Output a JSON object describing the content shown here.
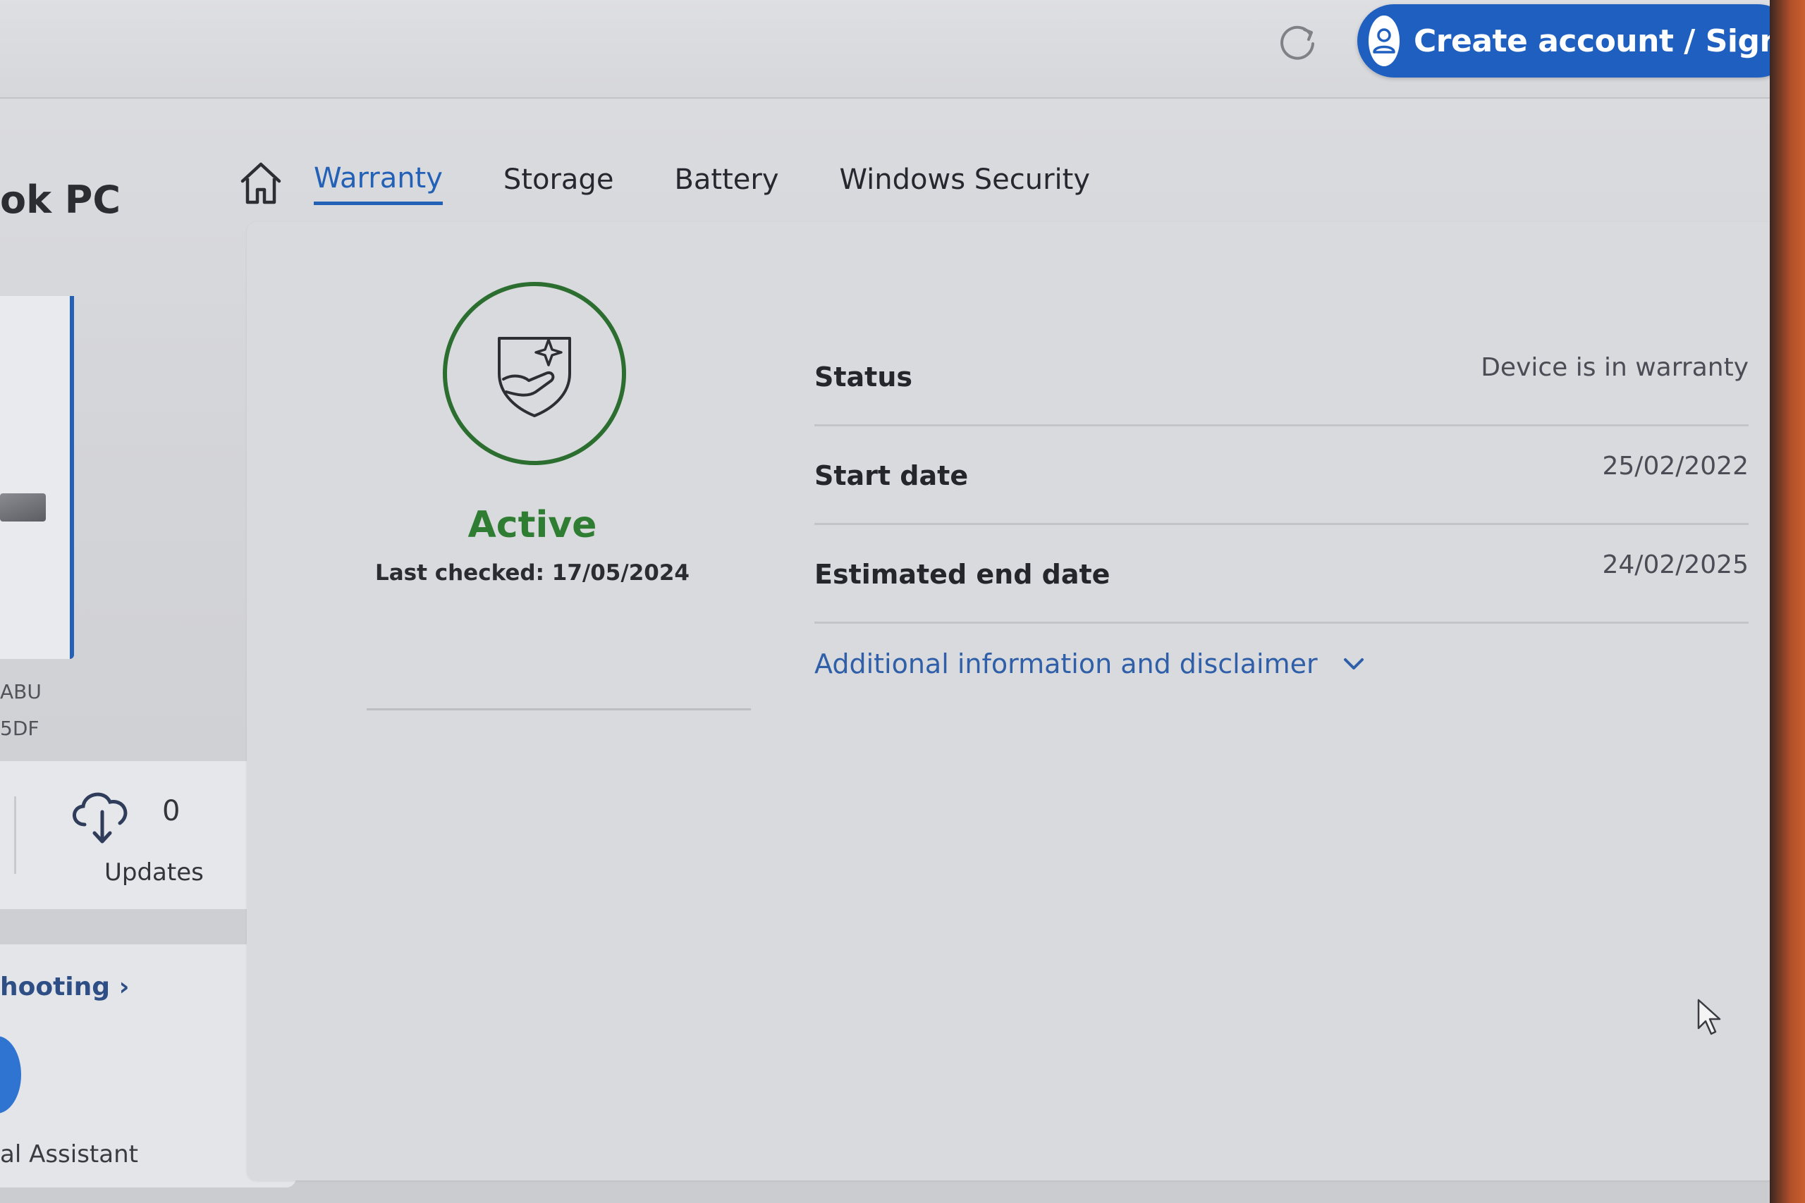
{
  "header": {
    "account_button_label": "Create account / Sign in"
  },
  "device": {
    "title_fragment": "ok PC",
    "id_line_1": "ABU",
    "id_line_2": "5DF"
  },
  "tabs": [
    {
      "label": "Warranty",
      "active": true
    },
    {
      "label": "Storage",
      "active": false
    },
    {
      "label": "Battery",
      "active": false
    },
    {
      "label": "Windows Security",
      "active": false
    }
  ],
  "sidebar": {
    "updates_count": "0",
    "updates_label": "Updates",
    "troubleshooting_link": "hooting ›",
    "assistant_label": "al Assistant"
  },
  "warranty": {
    "status_big": "Active",
    "last_checked": "Last checked: 17/05/2024",
    "rows": [
      {
        "label": "Status",
        "value": "Device is in warranty"
      },
      {
        "label": "Start date",
        "value": "25/02/2022"
      },
      {
        "label": "Estimated end date",
        "value": "24/02/2025"
      }
    ],
    "disclaimer_link": "Additional information and disclaimer"
  },
  "colors": {
    "brand_blue": "#2361b6",
    "status_green": "#2e7d32"
  },
  "icons": [
    "refresh-icon",
    "user-icon",
    "chevron-down-icon",
    "home-icon",
    "cloud-download-icon",
    "shield-hand-icon",
    "mouse-cursor-icon"
  ]
}
